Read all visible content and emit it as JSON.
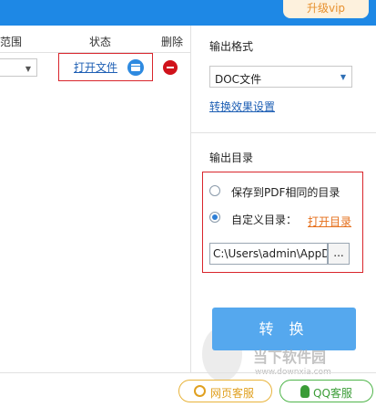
{
  "header": {
    "vip_label": "升级vip"
  },
  "table": {
    "columns": {
      "range": "范围",
      "status": "状态",
      "delete": "删除"
    },
    "row": {
      "open_file": "打开文件"
    }
  },
  "output_format": {
    "title": "输出格式",
    "selected": "DOC文件",
    "settings_link": "转换效果设置"
  },
  "output_dir": {
    "title": "输出目录",
    "option_same": "保存到PDF相同的目录",
    "option_custom": "自定义目录：",
    "selected_option": "custom",
    "open_dir_link": "打开目录",
    "path": "C:\\Users\\admin\\AppD",
    "browse_label": "..."
  },
  "convert_button": "转 换",
  "watermark": {
    "text": "当下软件园",
    "url": "www.downxia.com"
  },
  "footer": {
    "web_service": "网页客服",
    "qq_service": "QQ客服"
  },
  "colors": {
    "titlebar": "#1e88e5",
    "convert_button": "#55a8ee",
    "highlight_box": "#d9252c",
    "link": "#1e5fb4",
    "open_dir_link": "#e56f1b"
  }
}
